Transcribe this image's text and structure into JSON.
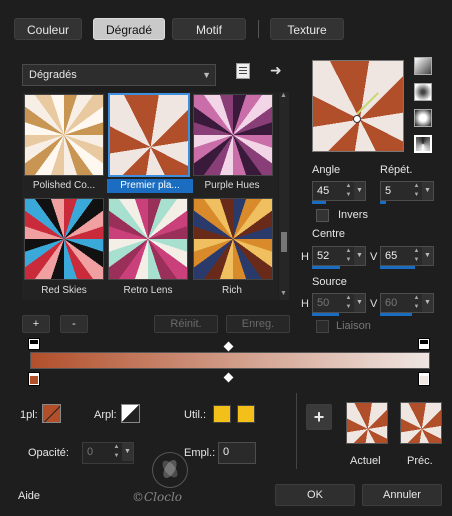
{
  "tabs": [
    {
      "label": "Couleur",
      "active": false
    },
    {
      "label": "Dégradé",
      "active": true
    },
    {
      "label": "Motif",
      "active": false
    },
    {
      "label": "Texture",
      "active": false
    }
  ],
  "category": {
    "selected": "Dégradés"
  },
  "gradients": [
    {
      "label": "Polished Co...",
      "selected": false
    },
    {
      "label": "Premier pla...",
      "selected": true
    },
    {
      "label": "Purple Hues",
      "selected": false
    },
    {
      "label": "Red Skies",
      "selected": false
    },
    {
      "label": "Retro Lens",
      "selected": false
    },
    {
      "label": "Rich",
      "selected": false
    }
  ],
  "gradient_buttons": {
    "add": "+",
    "remove": "-",
    "reset": "Réinit.",
    "save": "Enreg."
  },
  "angle": {
    "label": "Angle",
    "value": "45"
  },
  "repeat": {
    "label": "Répét.",
    "value": "5"
  },
  "invert": {
    "label": "Invers"
  },
  "centre": {
    "label": "Centre",
    "h_label": "H",
    "h_value": "52",
    "v_label": "V",
    "v_value": "65"
  },
  "source": {
    "label": "Source",
    "h_label": "H",
    "h_value": "50",
    "v_label": "V",
    "v_value": "60"
  },
  "link": {
    "label": "Liaison"
  },
  "stop_controls": {
    "opl_label": "1pl:",
    "arpl_label": "Arpl:",
    "util_label": "Util.:",
    "opacity_label": "Opacité:",
    "opacity_value": "0",
    "empl_label": "Empl.:",
    "empl_value": "0"
  },
  "previews": {
    "add": "+",
    "current_label": "Actuel",
    "previous_label": "Préc."
  },
  "watermark": "©Cloclo",
  "footer": {
    "help": "Aide",
    "ok": "OK",
    "cancel": "Annuler"
  },
  "colors": {
    "gradient_start": "#b24f2b",
    "gradient_end": "#efe6e2",
    "accent": "#1b6dc1",
    "util_color": "#f2c018"
  }
}
